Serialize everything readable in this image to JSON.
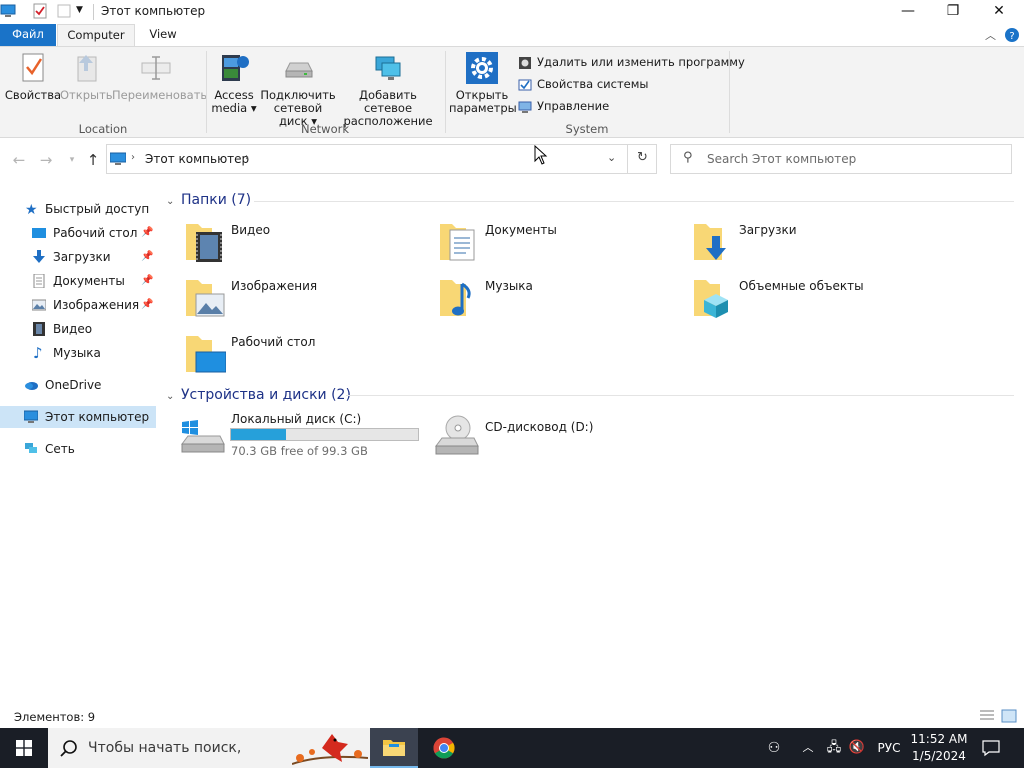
{
  "window": {
    "title": "Этот компьютер",
    "controls": {
      "minimize": "—",
      "maximize": "❐",
      "close": "✕"
    }
  },
  "ribbon": {
    "tabs": [
      {
        "label": "Файл"
      },
      {
        "label": "Computer"
      },
      {
        "label": "View"
      }
    ],
    "groups": {
      "location": {
        "label": "Location",
        "buttons": [
          {
            "label": "Свойства",
            "enabled": true
          },
          {
            "label": "Открыть",
            "enabled": false
          },
          {
            "label": "Переименовать",
            "enabled": false
          }
        ]
      },
      "network": {
        "label": "Network",
        "buttons": [
          {
            "line1": "Access",
            "line2": "media ▾"
          },
          {
            "line1": "Подключить",
            "line2": "сетевой диск ▾"
          },
          {
            "line1": "Добавить сетевое",
            "line2": "расположение"
          }
        ]
      },
      "system": {
        "label": "System",
        "open_settings": {
          "line1": "Открыть",
          "line2": "параметры"
        },
        "commands": [
          {
            "label": "Удалить или изменить программу"
          },
          {
            "label": "Свойства системы"
          },
          {
            "label": "Управление"
          }
        ]
      }
    }
  },
  "navigation": {
    "breadcrumb": [
      "Этот компьютер"
    ],
    "search_placeholder": "Search Этот компьютер"
  },
  "sidebar": {
    "quick_access": "Быстрый доступ",
    "pinned": [
      {
        "label": "Рабочий стол",
        "pinned": true
      },
      {
        "label": "Загрузки",
        "pinned": true
      },
      {
        "label": "Документы",
        "pinned": true
      },
      {
        "label": "Изображения",
        "pinned": true
      },
      {
        "label": "Видео",
        "pinned": false
      },
      {
        "label": "Музыка",
        "pinned": false
      }
    ],
    "onedrive": "OneDrive",
    "this_pc": "Этот компьютер",
    "network": "Сеть"
  },
  "folders": {
    "header": "Папки (7)",
    "items": [
      {
        "label": "Видео",
        "icon": "video-folder-icon"
      },
      {
        "label": "Документы",
        "icon": "documents-folder-icon"
      },
      {
        "label": "Загрузки",
        "icon": "downloads-folder-icon"
      },
      {
        "label": "Изображения",
        "icon": "pictures-folder-icon"
      },
      {
        "label": "Музыка",
        "icon": "music-folder-icon"
      },
      {
        "label": "Объемные объекты",
        "icon": "3d-objects-folder-icon"
      },
      {
        "label": "Рабочий стол",
        "icon": "desktop-folder-icon"
      }
    ]
  },
  "devices": {
    "header": "Устройства и диски (2)",
    "items": [
      {
        "label": "Локальный диск (C:)",
        "free_text": "70.3 GB free of 99.3 GB",
        "used_fraction": 0.292
      },
      {
        "label": "CD-дисковод (D:)"
      }
    ]
  },
  "status": {
    "items_count": "Элементов: 9"
  },
  "taskbar": {
    "search_placeholder": "Чтобы начать поиск,",
    "language": "РУС",
    "time": "11:52 AM",
    "date": "1/5/2024"
  },
  "colors": {
    "accent": "#1a73c8",
    "selection": "#cce4f7",
    "drive_fill": "#26a0da",
    "taskbar": "#1a1e26"
  }
}
